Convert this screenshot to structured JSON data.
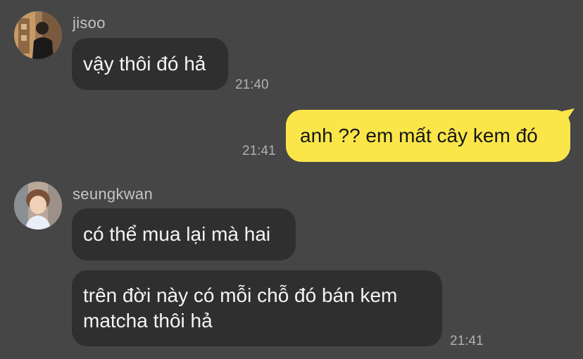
{
  "messages": [
    {
      "sender": "jisoo",
      "avatar_icon": "profile-photo-jisoo",
      "bubbles": [
        {
          "text": "vậy thôi đó hả",
          "time": "21:40"
        }
      ]
    },
    {
      "sender": "me",
      "bubbles": [
        {
          "text": "anh ?? em mất cây kem đó",
          "time": "21:41"
        }
      ]
    },
    {
      "sender": "seungkwan",
      "avatar_icon": "profile-photo-seungkwan",
      "bubbles": [
        {
          "text": "có thể mua lại mà hai"
        },
        {
          "text": "trên đời này có mỗi chỗ đó bán kem matcha thôi hả",
          "time": "21:41"
        }
      ]
    }
  ],
  "colors": {
    "background": "#464646",
    "incoming_bubble": "#2f2f2f",
    "outgoing_bubble": "#fbe64a",
    "meta_text": "#b0b0b0"
  }
}
